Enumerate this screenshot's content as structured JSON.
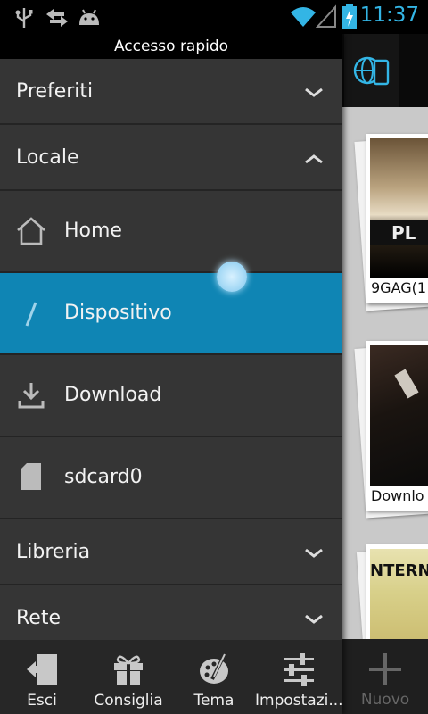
{
  "status": {
    "time": "11:37"
  },
  "drawer": {
    "title": "Accesso rapido",
    "sections": [
      {
        "label": "Preferiti"
      },
      {
        "label": "Locale"
      },
      {
        "label": "Libreria"
      },
      {
        "label": "Rete"
      }
    ],
    "items": [
      {
        "label": "Home",
        "icon": "home-icon"
      },
      {
        "label": "Dispositivo",
        "icon": "slash-icon",
        "selected": true
      },
      {
        "label": "Download",
        "icon": "download-icon"
      },
      {
        "label": "sdcard0",
        "icon": "sdcard-icon"
      }
    ],
    "bottom": [
      {
        "label": "Esci",
        "icon": "exit-icon"
      },
      {
        "label": "Consiglia",
        "icon": "gift-icon"
      },
      {
        "label": "Tema",
        "icon": "palette-icon"
      },
      {
        "label": "Impostazi...",
        "icon": "settings-sliders-icon"
      }
    ]
  },
  "background": {
    "cards": [
      {
        "caption": "9GAG(1"
      },
      {
        "caption": "Downlo"
      },
      {
        "caption": ""
      }
    ],
    "thumb_text": "PL",
    "thumb_text_2": "NTERNE",
    "nuovo_label": "Nuovo"
  },
  "colors": {
    "accent": "#33b5e5",
    "selected_bg": "#0f85b4",
    "drawer_bg": "#353535"
  }
}
